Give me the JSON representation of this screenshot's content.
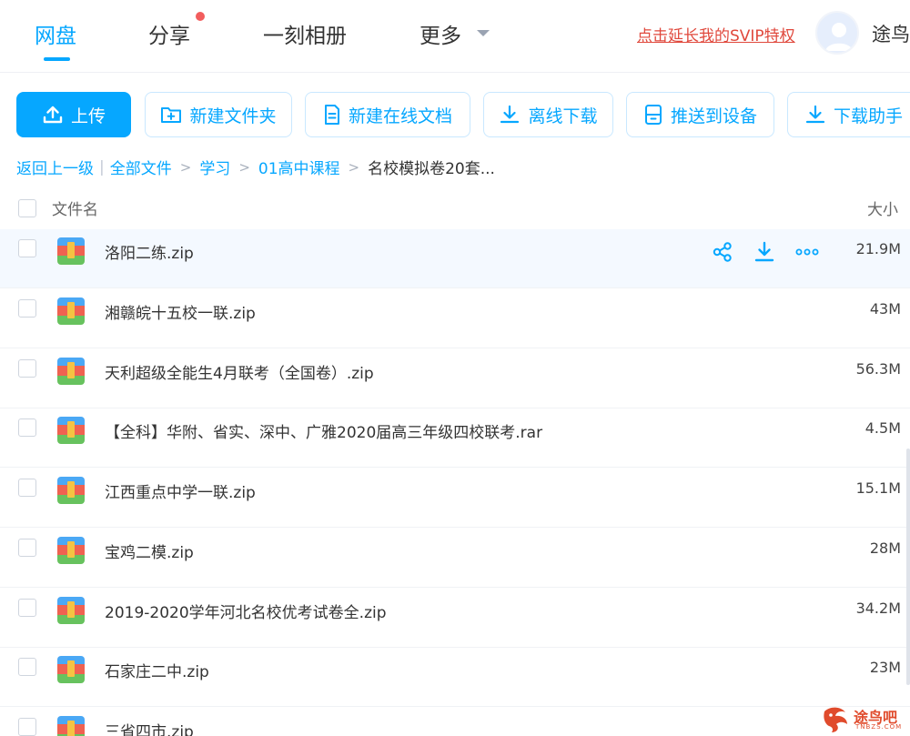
{
  "nav": {
    "items": [
      {
        "label": "网盘",
        "active": true
      },
      {
        "label": "分享",
        "badge": true
      },
      {
        "label": "一刻相册"
      },
      {
        "label": "更多"
      }
    ],
    "svip_link": "点击延长我的SVIP特权",
    "username": "途鸟"
  },
  "toolbar": {
    "upload": "上传",
    "new_folder": "新建文件夹",
    "new_doc": "新建在线文档",
    "offline_download": "离线下载",
    "push_device": "推送到设备",
    "download_helper": "下载助手"
  },
  "breadcrumb": {
    "back": "返回上一级",
    "all_files": "全部文件",
    "level1": "学习",
    "level2": "01高中课程",
    "current": "名校模拟卷20套..."
  },
  "list": {
    "header_name": "文件名",
    "header_size": "大小",
    "files": [
      {
        "name": "洛阳二练.zip",
        "size": "21.9M"
      },
      {
        "name": "湘赣皖十五校一联.zip",
        "size": "43M"
      },
      {
        "name": "天利超级全能生4月联考（全国卷）.zip",
        "size": "56.3M"
      },
      {
        "name": "【全科】华附、省实、深中、广雅2020届高三年级四校联考.rar",
        "size": "4.5M"
      },
      {
        "name": "江西重点中学一联.zip",
        "size": "15.1M"
      },
      {
        "name": "宝鸡二模.zip",
        "size": "28M"
      },
      {
        "name": "2019-2020学年河北名校优考试卷全.zip",
        "size": "34.2M"
      },
      {
        "name": "石家庄二中.zip",
        "size": "23M"
      },
      {
        "name": "三省四市.zip",
        "size": ""
      }
    ]
  },
  "watermark": {
    "text": "途鸟吧",
    "sub": "TNBZS.COM"
  },
  "colors": {
    "accent": "#06a7ff",
    "svip_red": "#e0483c",
    "badge_red": "#f25d5d"
  }
}
